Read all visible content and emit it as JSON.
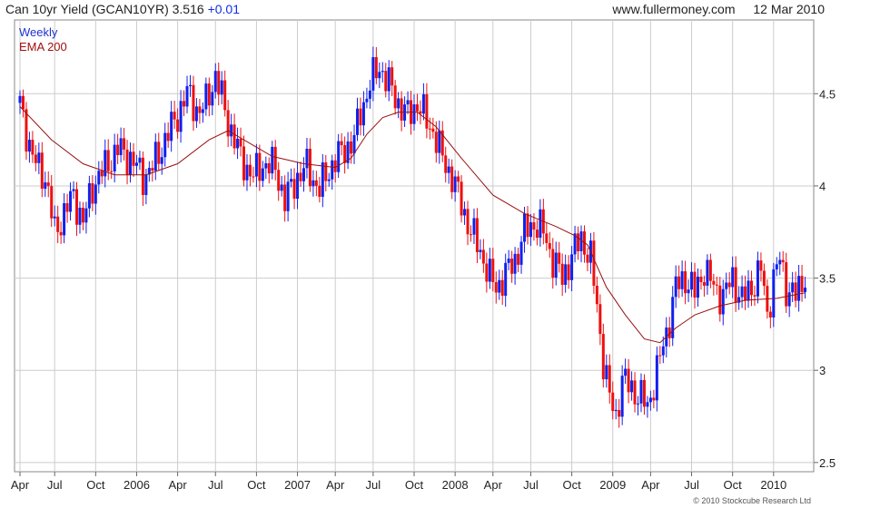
{
  "header": {
    "title": "Can 10yr Yield (GCAN10YR) 3.516",
    "change": "+0.01",
    "site": "www.fullermoney.com",
    "date": "12 Mar 2010"
  },
  "legend": {
    "period": "Weekly",
    "ema": "EMA 200",
    "period_color": "#2030d0",
    "ema_color": "#a01010"
  },
  "copyright": "© 2010 Stockcube Research Ltd",
  "colors": {
    "up": "#1020ee",
    "down": "#ee1010",
    "ema": "#991010",
    "grid": "#cccccc"
  },
  "chart_data": {
    "type": "candlestick",
    "title": "Can 10yr Yield (GCAN10YR) 3.516",
    "frequency": "Weekly",
    "y_axis_position": "right",
    "ylim": [
      2.45,
      4.9
    ],
    "yticks": [
      2.5,
      3,
      3.5,
      4,
      4.5
    ],
    "xlim": [
      0,
      250
    ],
    "xticks": [
      {
        "label": "Apr",
        "week": 0
      },
      {
        "label": "Jul",
        "week": 11
      },
      {
        "label": "Oct",
        "week": 24
      },
      {
        "label": "2006",
        "week": 37
      },
      {
        "label": "Apr",
        "week": 50
      },
      {
        "label": "Jul",
        "week": 62
      },
      {
        "label": "Oct",
        "week": 75
      },
      {
        "label": "2007",
        "week": 88
      },
      {
        "label": "Apr",
        "week": 100
      },
      {
        "label": "Jul",
        "week": 112
      },
      {
        "label": "Oct",
        "week": 125
      },
      {
        "label": "2008",
        "week": 138
      },
      {
        "label": "Apr",
        "week": 150
      },
      {
        "label": "Jul",
        "week": 162
      },
      {
        "label": "Oct",
        "week": 175
      },
      {
        "label": "2009",
        "week": 188
      },
      {
        "label": "Apr",
        "week": 200
      },
      {
        "label": "Jul",
        "week": 213
      },
      {
        "label": "Oct",
        "week": 226
      },
      {
        "label": "2010",
        "week": 239
      }
    ],
    "price_path": [
      [
        0,
        4.45
      ],
      [
        4,
        4.15
      ],
      [
        8,
        4.05
      ],
      [
        11,
        3.75
      ],
      [
        14,
        3.85
      ],
      [
        17,
        3.95
      ],
      [
        20,
        3.8
      ],
      [
        23,
        4.0
      ],
      [
        27,
        4.1
      ],
      [
        31,
        4.2
      ],
      [
        35,
        4.15
      ],
      [
        39,
        4.05
      ],
      [
        42,
        4.1
      ],
      [
        46,
        4.25
      ],
      [
        49,
        4.35
      ],
      [
        53,
        4.5
      ],
      [
        57,
        4.4
      ],
      [
        59,
        4.45
      ],
      [
        62,
        4.6
      ],
      [
        66,
        4.35
      ],
      [
        70,
        4.15
      ],
      [
        74,
        4.05
      ],
      [
        77,
        4.12
      ],
      [
        81,
        4.1
      ],
      [
        84,
        3.92
      ],
      [
        88,
        4.05
      ],
      [
        91,
        4.1
      ],
      [
        95,
        3.98
      ],
      [
        99,
        4.12
      ],
      [
        103,
        4.2
      ],
      [
        106,
        4.25
      ],
      [
        108,
        4.4
      ],
      [
        111,
        4.55
      ],
      [
        114,
        4.65
      ],
      [
        117,
        4.55
      ],
      [
        120,
        4.45
      ],
      [
        123,
        4.38
      ],
      [
        126,
        4.45
      ],
      [
        129,
        4.35
      ],
      [
        131,
        4.3
      ],
      [
        134,
        4.15
      ],
      [
        137,
        4.05
      ],
      [
        140,
        3.9
      ],
      [
        143,
        3.75
      ],
      [
        146,
        3.65
      ],
      [
        149,
        3.5
      ],
      [
        151,
        3.45
      ],
      [
        154,
        3.52
      ],
      [
        157,
        3.6
      ],
      [
        160,
        3.75
      ],
      [
        163,
        3.8
      ],
      [
        166,
        3.75
      ],
      [
        169,
        3.6
      ],
      [
        172,
        3.5
      ],
      [
        175,
        3.62
      ],
      [
        178,
        3.72
      ],
      [
        181,
        3.6
      ],
      [
        183,
        3.35
      ],
      [
        185,
        3.05
      ],
      [
        187,
        2.85
      ],
      [
        189,
        2.75
      ],
      [
        191,
        2.95
      ],
      [
        194,
        2.9
      ],
      [
        197,
        2.85
      ],
      [
        199,
        2.8
      ],
      [
        202,
        3.0
      ],
      [
        205,
        3.2
      ],
      [
        208,
        3.45
      ],
      [
        211,
        3.5
      ],
      [
        214,
        3.42
      ],
      [
        217,
        3.55
      ],
      [
        220,
        3.45
      ],
      [
        223,
        3.4
      ],
      [
        226,
        3.5
      ],
      [
        229,
        3.38
      ],
      [
        232,
        3.45
      ],
      [
        235,
        3.55
      ],
      [
        237,
        3.3
      ],
      [
        239,
        3.5
      ],
      [
        241,
        3.6
      ],
      [
        243,
        3.45
      ],
      [
        246,
        3.4
      ],
      [
        249,
        3.52
      ]
    ],
    "ema_path": [
      [
        0,
        4.43
      ],
      [
        10,
        4.25
      ],
      [
        20,
        4.12
      ],
      [
        30,
        4.06
      ],
      [
        40,
        4.06
      ],
      [
        50,
        4.12
      ],
      [
        60,
        4.25
      ],
      [
        66,
        4.3
      ],
      [
        72,
        4.24
      ],
      [
        80,
        4.16
      ],
      [
        90,
        4.12
      ],
      [
        100,
        4.1
      ],
      [
        105,
        4.15
      ],
      [
        110,
        4.28
      ],
      [
        115,
        4.37
      ],
      [
        120,
        4.4
      ],
      [
        126,
        4.4
      ],
      [
        132,
        4.32
      ],
      [
        140,
        4.15
      ],
      [
        150,
        3.95
      ],
      [
        160,
        3.85
      ],
      [
        170,
        3.78
      ],
      [
        176,
        3.73
      ],
      [
        180,
        3.68
      ],
      [
        186,
        3.45
      ],
      [
        192,
        3.3
      ],
      [
        198,
        3.17
      ],
      [
        203,
        3.15
      ],
      [
        208,
        3.23
      ],
      [
        214,
        3.3
      ],
      [
        222,
        3.35
      ],
      [
        230,
        3.38
      ],
      [
        240,
        3.39
      ],
      [
        249,
        3.42
      ]
    ],
    "ema_label": "EMA 200"
  }
}
